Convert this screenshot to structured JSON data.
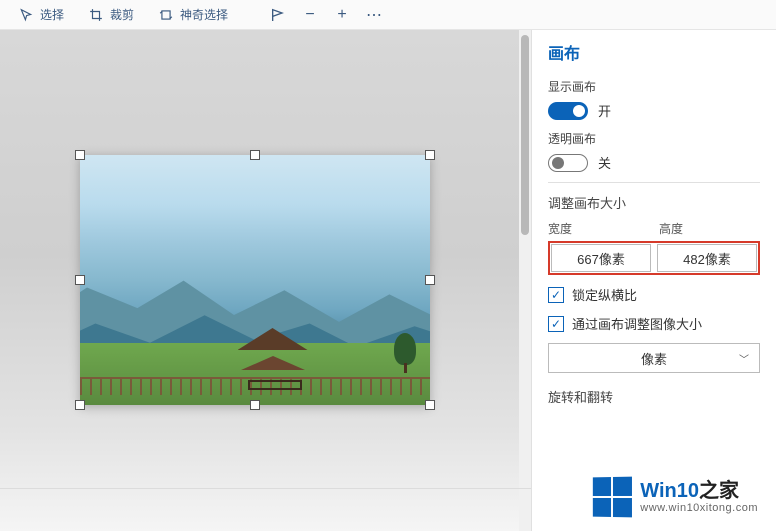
{
  "toolbar": {
    "select": "选择",
    "crop": "裁剪",
    "magic_select": "神奇选择"
  },
  "panel": {
    "title": "画布",
    "show_canvas": {
      "label": "显示画布",
      "state": "开"
    },
    "transparent_canvas": {
      "label": "透明画布",
      "state": "关"
    },
    "resize_title": "调整画布大小",
    "width_label": "宽度",
    "height_label": "高度",
    "width_value": "667像素",
    "height_value": "482像素",
    "lock_ratio": "锁定纵横比",
    "resize_image_with_canvas": "通过画布调整图像大小",
    "unit": "像素",
    "rotate_flip_title": "旋转和翻转"
  },
  "watermark": {
    "brand1": "Win10",
    "brand2": "之家",
    "url": "www.win10xitong.com"
  }
}
